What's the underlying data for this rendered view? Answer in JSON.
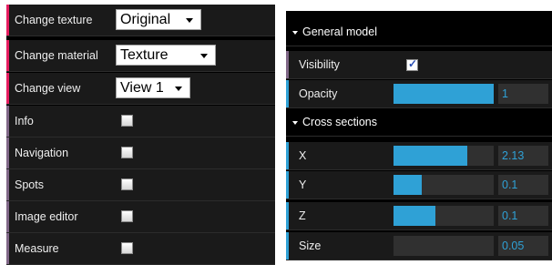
{
  "left_panel": {
    "change_texture": {
      "label": "Change texture",
      "value": "Original"
    },
    "change_material": {
      "label": "Change material",
      "value": "Texture"
    },
    "change_view": {
      "label": "Change view",
      "value": "View 1"
    },
    "toggles": {
      "info": {
        "label": "Info",
        "checked": false
      },
      "navigation": {
        "label": "Navigation",
        "checked": false
      },
      "spots": {
        "label": "Spots",
        "checked": false
      },
      "image_editor": {
        "label": "Image editor",
        "checked": false
      },
      "measure": {
        "label": "Measure",
        "checked": false
      }
    }
  },
  "right_panel": {
    "general_model": {
      "title": "General model",
      "visibility": {
        "label": "Visibility",
        "checked": true,
        "check_glyph": "✓"
      },
      "opacity": {
        "label": "Opacity",
        "value": "1",
        "fill": 1.0
      }
    },
    "cross_sections": {
      "title": "Cross sections",
      "x": {
        "label": "X",
        "value": "2.13",
        "fill": 0.74
      },
      "y": {
        "label": "Y",
        "value": "0.1",
        "fill": 0.28
      },
      "z": {
        "label": "Z",
        "value": "0.1",
        "fill": 0.42
      },
      "size": {
        "label": "Size",
        "value": "0.05",
        "fill": 0.0
      }
    }
  },
  "colors": {
    "slider_fill": "#2fa1d6",
    "accent_red": "#e61d5f",
    "accent_purple": "#806787",
    "row_background": "#1a1a1a",
    "panel_background": "#000000"
  },
  "icons": {
    "dropdown": "caret-down-icon",
    "folder": "triangle-down-icon",
    "checkmark": "checkmark-icon"
  }
}
